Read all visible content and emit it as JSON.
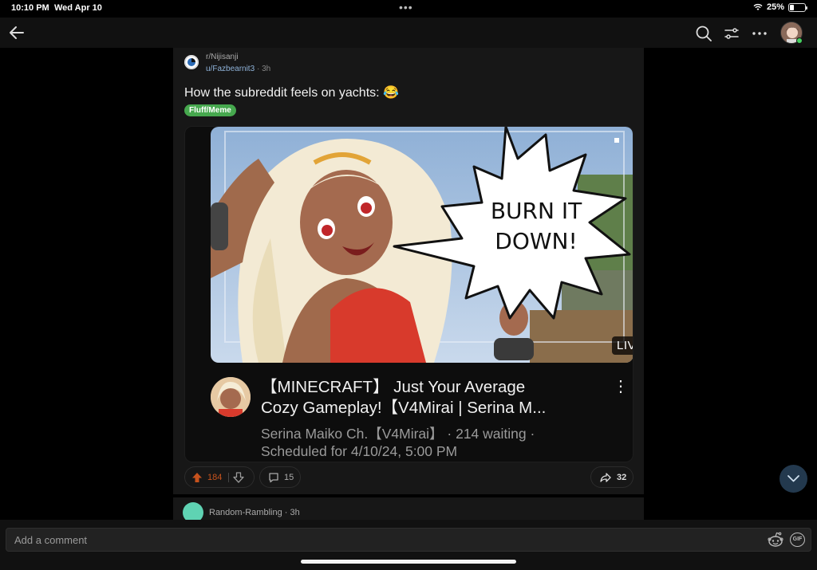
{
  "status_bar": {
    "time": "10:10 PM",
    "date": "Wed Apr 10",
    "battery": "25%",
    "battery_level": 0.25
  },
  "nav": {
    "icons": [
      "back-arrow-icon",
      "search-icon",
      "filter-icon",
      "more-icon",
      "user-avatar"
    ]
  },
  "post": {
    "subreddit": "r/Nijisanji",
    "author": "u/Fazbearnit3",
    "separator": "·",
    "time": "3h",
    "title": "How the subreddit feels on yachts: 😂",
    "flair": "Fluff/Meme",
    "flair_color": "#46a84e",
    "embed": {
      "speech_bubble_line1": "BURN IT",
      "speech_bubble_line2": "DOWN!",
      "live_label": "LIVE",
      "video_title_line1": "【MINECRAFT】 Just Your Average",
      "video_title_line2": "Cozy Gameplay!【V4Mirai | Serina M...",
      "channel_line1": "Serina Maiko Ch.【V4Mirai】  · 214 waiting ·",
      "channel_line2": "Scheduled for 4/10/24, 5:00 PM"
    },
    "actions": {
      "upvotes": "184",
      "comments": "15",
      "shares": "32",
      "upvote_color": "#c6521d"
    }
  },
  "next_post": {
    "subreddit": "Random-Rambling",
    "separator": "·",
    "time": "3h"
  },
  "comment_bar": {
    "placeholder": "Add a comment",
    "gif_label": "GIF"
  }
}
